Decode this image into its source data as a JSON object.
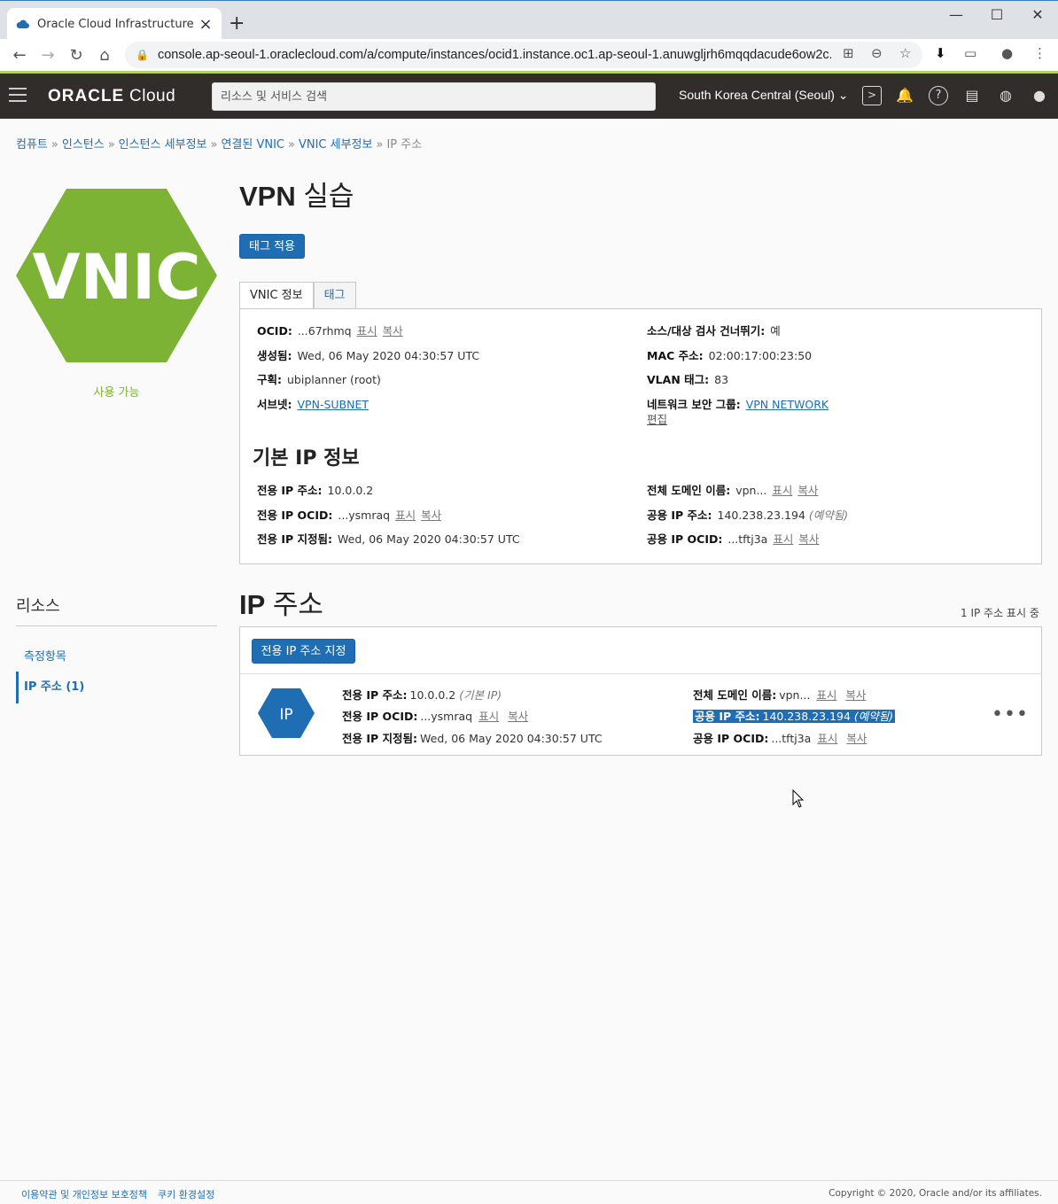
{
  "browser": {
    "tab_title": "Oracle Cloud Infrastructure",
    "url": "console.ap-seoul-1.oraclecloud.com/a/compute/instances/ocid1.instance.oc1.ap-seoul-1.anuwgljrh6mqqdacude6ow2c..."
  },
  "header": {
    "logo_bold": "ORACLE",
    "logo_light": " Cloud",
    "search_placeholder": "리소스 및 서비스 검색",
    "region": "South Korea Central (Seoul)"
  },
  "breadcrumb": {
    "items": [
      "컴퓨트",
      "인스턴스",
      "인스턴스 세부정보",
      "연결된 VNIC",
      "VNIC 세부정보"
    ],
    "current": "IP 주소",
    "sep": "»"
  },
  "resource": {
    "hex_label": "VNIC",
    "status": "사용 가능",
    "title_bold": "VPN",
    "title_light": " 실습",
    "apply_tags_label": "태그 적용"
  },
  "tabs": [
    "VNIC 정보",
    "태그"
  ],
  "vnic_info": {
    "ocid_label": "OCID:",
    "ocid_value": "...67rhmq",
    "show": "표시",
    "copy": "복사",
    "created_label": "생성됨:",
    "created_value": "Wed, 06 May 2020 04:30:57 UTC",
    "compartment_label": "구획:",
    "compartment_value": "ubiplanner (root)",
    "subnet_label": "서브넷:",
    "subnet_value": "VPN-SUBNET",
    "skip_check_label": "소스/대상 검사 건너뛰기:",
    "skip_check_value": "예",
    "mac_label": "MAC 주소:",
    "mac_value": "02:00:17:00:23:50",
    "vlan_label": "VLAN 태그:",
    "vlan_value": "83",
    "nsg_label": "네트워크 보안 그룹:",
    "nsg_value": "VPN NETWORK",
    "edit": "편집"
  },
  "primary_ip": {
    "heading": "기본 IP 정보",
    "private_ip_label": "전용 IP 주소:",
    "private_ip_value": "10.0.0.2",
    "private_ocid_label": "전용 IP OCID:",
    "private_ocid_value": "...ysmraq",
    "assigned_label": "전용 IP 지정됨:",
    "assigned_value": "Wed, 06 May 2020 04:30:57 UTC",
    "fqdn_label": "전체 도메인 이름:",
    "fqdn_value": "vpn...",
    "public_ip_label": "공용 IP 주소:",
    "public_ip_value": "140.238.23.194",
    "reserved": "(예약됨)",
    "public_ocid_label": "공용 IP OCID:",
    "public_ocid_value": "...tftj3a"
  },
  "sidebar": {
    "heading": "리소스",
    "items": [
      "측정항목",
      "IP 주소 (1)"
    ]
  },
  "ip_section": {
    "title_bold": "IP",
    "title_light": " 주소",
    "showing": "1 IP 주소 표시 중",
    "assign_button": "전용 IP 주소 지정",
    "row": {
      "badge": "IP",
      "private_ip_label": "전용 IP 주소:",
      "private_ip_value": "10.0.0.2",
      "primary_tag": "(기본 IP)",
      "private_ocid_label": "전용 IP OCID:",
      "private_ocid_value": "...ysmraq",
      "assigned_label": "전용 IP 지정됨:",
      "assigned_value": "Wed, 06 May 2020 04:30:57 UTC",
      "fqdn_label": "전체 도메인 이름:",
      "fqdn_value": "vpn...",
      "public_ip_label": "공용 IP 주소:",
      "public_ip_value": "140.238.23.194",
      "reserved": "(예약됨)",
      "public_ocid_label": "공용 IP OCID:",
      "public_ocid_value": "...tftj3a",
      "show": "표시",
      "copy": "복사",
      "menu": "•••"
    }
  },
  "footer": {
    "privacy": "이용약관 및 개인정보 보호정책",
    "cookies": "쿠키 환경설정",
    "copyright": "Copyright © 2020, Oracle and/or its affiliates."
  },
  "colors": {
    "brand_header": "#312d2a",
    "link_blue": "#1f6db3",
    "vnic_green": "#7db334"
  }
}
